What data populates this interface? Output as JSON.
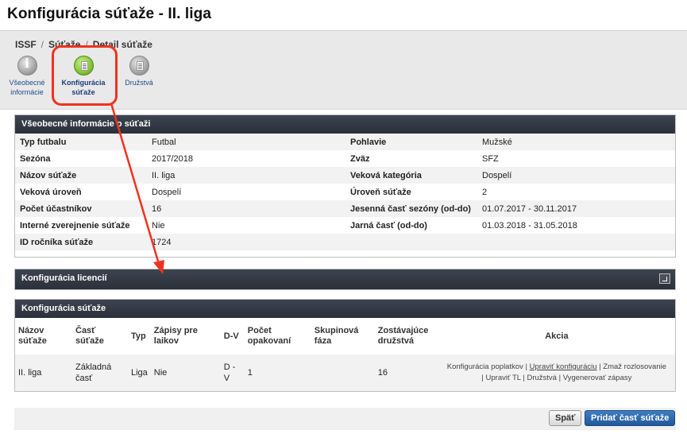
{
  "page_title": "Konfigurácia súťaže - II. liga",
  "breadcrumb": [
    "ISSF",
    "Súťaže",
    "Detail súťaže"
  ],
  "nav_tabs": [
    {
      "line1": "Všeobecné",
      "line2": "informácie",
      "icon": "info-icon"
    },
    {
      "line1": "Konfigurácia",
      "line2": "súťaže",
      "icon": "config-document-icon"
    },
    {
      "line1": "Družstvá",
      "line2": "",
      "icon": "teams-document-icon"
    }
  ],
  "general_info": {
    "title": "Všeobecné informácie o súťaži",
    "rows": [
      {
        "l1": "Typ futbalu",
        "v1": "Futbal",
        "l2": "Pohlavie",
        "v2": "Mužské"
      },
      {
        "l1": "Sezóna",
        "v1": "2017/2018",
        "l2": "Zväz",
        "v2": "SFZ"
      },
      {
        "l1": "Názov súťaže",
        "v1": "II. liga",
        "l2": "Veková kategória",
        "v2": "Dospelí"
      },
      {
        "l1": "Veková úroveň",
        "v1": "Dospelí",
        "l2": "Úroveň súťaže",
        "v2": "2"
      },
      {
        "l1": "Počet účastníkov",
        "v1": "16",
        "l2": "Jesenná časť sezóny (od-do)",
        "v2": "01.07.2017 - 30.11.2017"
      },
      {
        "l1": "Interné zverejnenie súťaže",
        "v1": "Nie",
        "l2": "Jarná časť (od-do)",
        "v2": "01.03.2018 - 31.05.2018"
      },
      {
        "l1": "ID ročníka súťaže",
        "v1": "1724",
        "l2": "",
        "v2": ""
      }
    ]
  },
  "license_config": {
    "title": "Konfigurácia licencií"
  },
  "competition_config": {
    "title": "Konfigurácia súťaže",
    "headers": {
      "name": "Názov súťaže",
      "part": "Časť súťaže",
      "type": "Typ",
      "records": "Zápisy pre laikov",
      "dv": "D-V",
      "repeats": "Počet opakovaní",
      "group": "Skupinová fáza",
      "remaining": "Zostávajúce družstvá",
      "action": "Akcia"
    },
    "row": {
      "name": "II. liga",
      "part": "Základná časť",
      "type": "Liga",
      "records": "Nie",
      "dv": "D - V",
      "repeats": "1",
      "group": "",
      "remaining": "16"
    },
    "actions": {
      "fees": "Konfigurácia poplatkov",
      "edit": "Upraviť konfiguráciu",
      "delete_draw": "Zmaž rozlosovanie",
      "edit_tl": "Upraviť TL",
      "teams": "Družstvá",
      "generate": "Vygenerovať zápasy",
      "sep": "|"
    }
  },
  "buttons": {
    "back": "Späť",
    "add_part": "Pridať časť súťaže"
  },
  "colors": {
    "panel_header": "#2f3540",
    "highlight": "#f0321e",
    "primary_button": "#2a64a8"
  }
}
